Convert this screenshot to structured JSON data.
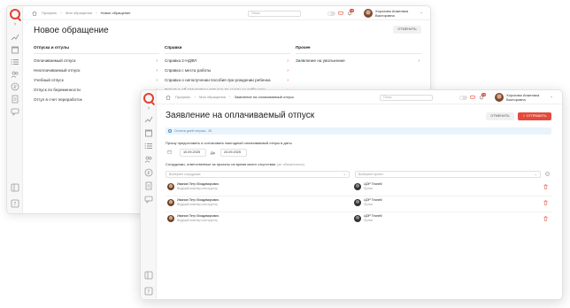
{
  "back_window": {
    "breadcrumbs": [
      "Профиль",
      "Мои обращения",
      "Новое обращение"
    ],
    "search": {
      "placeholder": "Поиск"
    },
    "notifications_count": "15",
    "user": {
      "name_line1": "Хорохова Анжелика",
      "name_line2": "Викторовна"
    },
    "page_title": "Новое обращение",
    "cancel_label": "ОТМЕНИТЬ",
    "columns": [
      {
        "title": "Отпуска и отгулы",
        "items": [
          "Оплачиваемый отпуск",
          "Неоплачиваемый отпуск",
          "Учебный отпуск",
          "Отпуск по беременности",
          "Отгул в счет переработок"
        ]
      },
      {
        "title": "Справки",
        "items": [
          "Справка 2-НДФЛ",
          "Справка с места работы",
          "Справка о неполучении пособия при рождении ребенка",
          "Справка об отсутствии отпуска по уходу за ребенком"
        ]
      },
      {
        "title": "Прочее",
        "items": [
          "Заявление на увольнение"
        ]
      }
    ]
  },
  "front_window": {
    "breadcrumbs": [
      "Профиль",
      "Мои обращения",
      "Заявление на оплачиваемый отпуск"
    ],
    "search": {
      "placeholder": "Поиск"
    },
    "notifications_count": "15",
    "user": {
      "name_line1": "Хорохова Анжелика",
      "name_line2": "Викторовна"
    },
    "page_title": "Заявление на оплачиваемый отпуск",
    "cancel_label": "ОТМЕНИТЬ",
    "submit_label": "ОТПРАВИТЬ",
    "notice": "Остаток дней отпуска - 28",
    "period_label": "Прошу предоставить и согласовать ежегодный оплачиваемый отпуск в даты",
    "date_from": "10.09.2025",
    "date_to_label": "До",
    "date_to": "24.09.2025",
    "responsible_label": "Сотрудники, ответственные за проекты на время моего отсутствия",
    "responsible_optional": "(не обязательно)",
    "employee_select_placeholder": "Выберите сотрудника",
    "project_select_placeholder": "Выберите проект",
    "rows": [
      {
        "name": "Иванов Петр Владимирович",
        "role": "Ведущий инженер-конструктор",
        "project": "ЦОР Тесней",
        "project_sub": "Проект"
      },
      {
        "name": "Иванов Петр Владимирович",
        "role": "Ведущий инженер-конструктор",
        "project": "ЦОР Тесней",
        "project_sub": "Проект"
      },
      {
        "name": "Иванов Петр Владимирович",
        "role": "Ведущий инженер-конструктор",
        "project": "ЦОР Тесней",
        "project_sub": "Проект"
      }
    ]
  },
  "colors": {
    "accent": "#e3412b",
    "notice_bg": "#e9f3fb",
    "notice_text": "#4b8fc3"
  }
}
